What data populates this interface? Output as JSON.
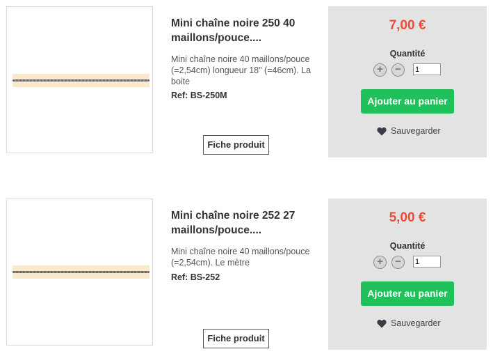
{
  "products": [
    {
      "title_line1": "Mini chaîne noire 250 40",
      "title_line2": "maillons/pouce....",
      "desc_line1": "Mini chaîne noire 40 maillons/pouce",
      "desc_line2": "(=2,54cm) longueur 18\" (=46cm). La",
      "desc_line3": "boite",
      "ref": "Ref: BS-250M",
      "fiche_label": "Fiche produit",
      "price": "7,00 €",
      "quantity_label": "Quantité",
      "quantity_value": "1",
      "add_to_cart_label": "Ajouter au panier",
      "save_label": "Sauvegarder"
    },
    {
      "title_line1": "Mini chaîne noire 252 27",
      "title_line2": "maillons/pouce....",
      "desc_line1": "Mini chaîne noire 40 maillons/pouce",
      "desc_line2": "(=2,54cm). Le mètre",
      "desc_line3": "",
      "ref": "Ref: BS-252",
      "fiche_label": "Fiche produit",
      "price": "5,00 €",
      "quantity_label": "Quantité",
      "quantity_value": "1",
      "add_to_cart_label": "Ajouter au panier",
      "save_label": "Sauvegarder"
    }
  ],
  "icons": {
    "increase": "plus-circle-icon",
    "decrease": "minus-circle-icon",
    "save": "heart-icon"
  },
  "colors": {
    "price": "#ee4b3b",
    "add_button": "#20c05a",
    "buy_box_bg": "#e3e3e3"
  }
}
